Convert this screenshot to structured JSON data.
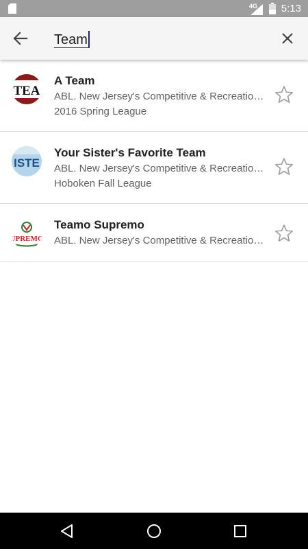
{
  "status_bar": {
    "network": "4G",
    "time": "5:13",
    "icons": [
      "sd-card-icon",
      "signal-icon",
      "battery-icon"
    ]
  },
  "search": {
    "query": "Team",
    "back_icon": "arrow-left-icon",
    "clear_icon": "close-icon"
  },
  "results": [
    {
      "name": "A Team",
      "league": "ABL. New Jersey's Competitive & Recreational Adult Baseball League",
      "season": "2016 Spring League",
      "logo_text": "TEA",
      "starred": false
    },
    {
      "name": "Your Sister's Favorite Team",
      "league": "ABL. New Jersey's Competitive & Recreational Adult Baseball League",
      "season": "Hoboken Fall League",
      "logo_text": "ISTE",
      "starred": false
    },
    {
      "name": "Teamo Supremo",
      "league": "ABL. New Jersey's Competitive & Recreational Adult Baseball League",
      "logo_text": "UPREMO",
      "starred": false
    }
  ],
  "colors": {
    "status_bar": "#9e9e9e",
    "search_bar": "#f5f5f5",
    "star_outline": "#9e9e9e",
    "nav_bar": "#000000"
  }
}
